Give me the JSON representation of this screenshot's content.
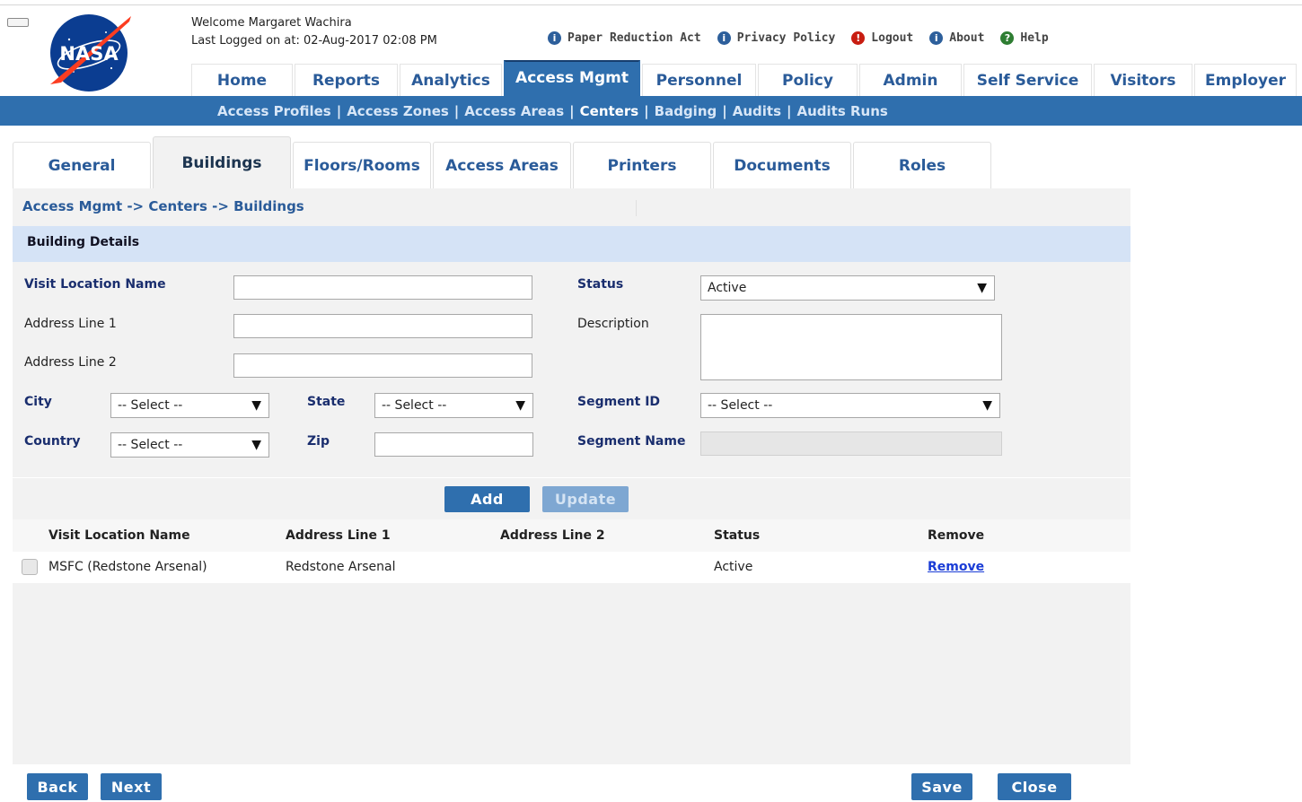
{
  "header": {
    "logo_text": "NASA",
    "welcome": "Welcome Margaret Wachira",
    "last_logged": "Last Logged on at: 02-Aug-2017 02:08 PM",
    "util_links": [
      {
        "label": "Paper Reduction Act",
        "icon": "info-icon"
      },
      {
        "label": "Privacy Policy",
        "icon": "info-icon"
      },
      {
        "label": "Logout",
        "icon": "logout-icon"
      },
      {
        "label": "About",
        "icon": "info-icon"
      },
      {
        "label": "Help",
        "icon": "help-icon"
      }
    ]
  },
  "nav": {
    "tabs": [
      "Home",
      "Reports",
      "Analytics",
      "Access Mgmt",
      "Personnel",
      "Policy",
      "Admin",
      "Self Service",
      "Visitors",
      "Employer"
    ],
    "active": "Access Mgmt"
  },
  "subnav": {
    "links": [
      "Access Profiles",
      "Access Zones",
      "Access Areas",
      "Centers",
      "Badging",
      "Audits",
      "Audits Runs"
    ],
    "separator": "|",
    "active": "Centers"
  },
  "page_tabs": {
    "tabs": [
      "General",
      "Buildings",
      "Floors/Rooms",
      "Access Areas",
      "Printers",
      "Documents",
      "Roles"
    ],
    "active": "Buildings"
  },
  "breadcrumb": "Access Mgmt -> Centers -> Buildings",
  "section_title": "Building Details",
  "form": {
    "visit_location_name": {
      "label": "Visit Location Name",
      "value": ""
    },
    "address_line_1": {
      "label": "Address Line 1",
      "value": ""
    },
    "address_line_2": {
      "label": "Address Line 2",
      "value": ""
    },
    "city": {
      "label": "City",
      "value": "-- Select --"
    },
    "state": {
      "label": "State",
      "value": "-- Select --"
    },
    "country": {
      "label": "Country",
      "value": "-- Select --"
    },
    "zip": {
      "label": "Zip",
      "value": ""
    },
    "status": {
      "label": "Status",
      "value": "Active"
    },
    "description": {
      "label": "Description",
      "value": ""
    },
    "segment_id": {
      "label": "Segment ID",
      "value": "-- Select --"
    },
    "segment_name": {
      "label": "Segment Name",
      "value": ""
    }
  },
  "buttons": {
    "add": "Add",
    "update": "Update",
    "back": "Back",
    "next": "Next",
    "save": "Save",
    "close": "Close"
  },
  "table": {
    "columns": [
      "Visit Location Name",
      "Address Line 1",
      "Address Line 2",
      "Status",
      "Remove"
    ],
    "rows": [
      {
        "visit_location_name": "MSFC (Redstone Arsenal)",
        "address_line_1": "Redstone Arsenal",
        "address_line_2": "",
        "status": "Active",
        "remove": "Remove"
      }
    ]
  },
  "colors": {
    "brand_blue": "#2f6fae",
    "link_blue": "#2a5b99",
    "section_bg": "#d5e3f6",
    "panel_bg": "#f2f2f2"
  }
}
